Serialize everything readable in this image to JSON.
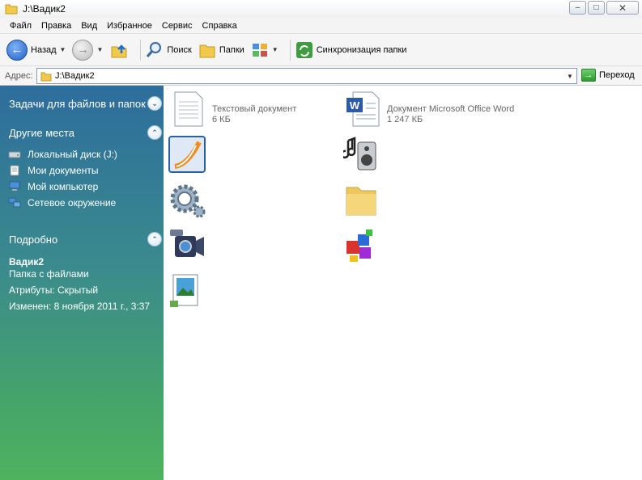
{
  "window": {
    "title": "J:\\Вадик2",
    "controls": {
      "minimize": "–",
      "maximize": "□",
      "close": "✕"
    }
  },
  "menu": [
    "Файл",
    "Правка",
    "Вид",
    "Избранное",
    "Сервис",
    "Справка"
  ],
  "toolbar": {
    "back_label": "Назад",
    "search_label": "Поиск",
    "folders_label": "Папки",
    "sync_label": "Синхронизация папки"
  },
  "address": {
    "label": "Адрес:",
    "value": "J:\\Вадик2",
    "go_label": "Переход"
  },
  "left_pane": {
    "tasks_title": "Задачи для файлов и папок",
    "places_title": "Другие места",
    "places": [
      "Локальный диск (J:)",
      "Мои документы",
      "Мой компьютер",
      "Сетевое окружение"
    ],
    "details_title": "Подробно",
    "details": {
      "name": "Вадик2",
      "type": "Папка с файлами",
      "attributes": "Атрибуты: Скрытый",
      "modified": "Изменен: 8 ноября 2011 г., 3:37"
    }
  },
  "files": [
    {
      "icon": "text-document-icon",
      "line1": "Текстовый документ",
      "line2": "6 КБ"
    },
    {
      "icon": "word-document-icon",
      "line1": "Документ Microsoft Office Word",
      "line2": "1 247 КБ"
    },
    {
      "icon": "presentation-app-icon"
    },
    {
      "icon": "music-icon"
    },
    {
      "icon": "settings-gears-icon"
    },
    {
      "icon": "folder-icon"
    },
    {
      "icon": "video-camera-icon"
    },
    {
      "icon": "games-icon"
    },
    {
      "icon": "images-icon"
    }
  ]
}
